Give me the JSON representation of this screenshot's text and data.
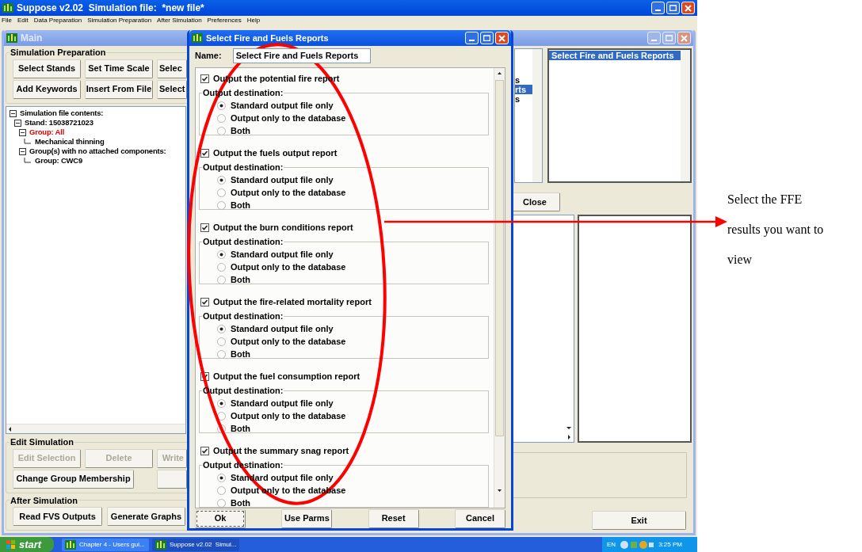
{
  "app_window": {
    "title": "Suppose v2.02  Simulation file:  *new file*"
  },
  "menu_bar": [
    "File",
    "Edit",
    "Data Preparation",
    "Simulation Preparation",
    "After Simulation",
    "Preferences",
    "Help"
  ],
  "main_window": {
    "title": "Main",
    "simulation_preparation": {
      "label": "Simulation Preparation",
      "buttons": [
        {
          "label": "Select Stands"
        },
        {
          "label": "Set Time Scale"
        },
        {
          "label": "Selec"
        },
        {
          "label": "Add Keywords"
        },
        {
          "label": "Insert From File"
        },
        {
          "label": "Select"
        }
      ]
    },
    "tree": [
      {
        "label": "Simulation file contents:",
        "color": "#000000",
        "children": [
          {
            "label": "Stand: 15038721023",
            "color": "#000000",
            "children": [
              {
                "label": "Group: All",
                "color": "#e00000",
                "children": [
                  {
                    "label": "Mechanical thinning",
                    "color": "#000000"
                  }
                ]
              },
              {
                "label": "Group(s) with no attached components:",
                "color": "#000000",
                "children": [
                  {
                    "label": "Group: CWC9",
                    "color": "#000000"
                  }
                ]
              }
            ]
          }
        ]
      }
    ],
    "edit_simulation": {
      "label": "Edit Simulation",
      "buttons": [
        {
          "kind": "text",
          "label": "Edit Selection",
          "disabled": true
        },
        {
          "kind": "text",
          "label": "Delete",
          "disabled": true
        },
        {
          "kind": "text",
          "label": "Write",
          "disabled": true
        },
        {
          "kind": "text",
          "label": "Change Group Membership",
          "disabled": false
        },
        {
          "kind": "blank",
          "disabled": false
        }
      ]
    },
    "after_simulation": {
      "label": "After Simulation",
      "buttons": [
        {
          "label": "Read FVS Outputs"
        },
        {
          "label": "Generate Graphs"
        }
      ]
    },
    "component_list": [
      {
        "label": "s",
        "selected": false
      },
      {
        "label": "rts",
        "selected": true
      },
      {
        "label": "s",
        "selected": false
      }
    ],
    "selected_components": [
      {
        "label": "Select Fire and Fuels Reports",
        "selected": true
      }
    ],
    "close_button": "Close",
    "exit_button": "Exit"
  },
  "dialog": {
    "title": "Select Fire and Fuels Reports",
    "name_label": "Name:",
    "name_value": "Select Fire and Fuels Reports",
    "reports": [
      {
        "label": "Output the potential fire report",
        "checked": true,
        "destination_label": "Output destination:",
        "options": [
          {
            "label": "Standard output file only",
            "selected": true
          },
          {
            "label": "Output only to the database",
            "selected": false
          },
          {
            "label": "Both",
            "selected": false
          }
        ]
      },
      {
        "label": "Output the fuels output report",
        "checked": true,
        "destination_label": "Output destination:",
        "options": [
          {
            "label": "Standard output file only",
            "selected": true
          },
          {
            "label": "Output only to the database",
            "selected": false
          },
          {
            "label": "Both",
            "selected": false
          }
        ]
      },
      {
        "label": "Output the burn conditions report",
        "checked": true,
        "destination_label": "Output destination:",
        "options": [
          {
            "label": "Standard output file only",
            "selected": true
          },
          {
            "label": "Output only to the database",
            "selected": false
          },
          {
            "label": "Both",
            "selected": false
          }
        ]
      },
      {
        "label": "Output the fire-related mortality report",
        "checked": true,
        "destination_label": "Output destination:",
        "options": [
          {
            "label": "Standard output file only",
            "selected": true
          },
          {
            "label": "Output only to the database",
            "selected": false
          },
          {
            "label": "Both",
            "selected": false
          }
        ]
      },
      {
        "label": "Output the fuel consumption report",
        "checked": true,
        "destination_label": "Output destination:",
        "options": [
          {
            "label": "Standard output file only",
            "selected": true
          },
          {
            "label": "Output only to the database",
            "selected": false
          },
          {
            "label": "Both",
            "selected": false
          }
        ]
      },
      {
        "label": "Output the summary snag report",
        "checked": true,
        "destination_label": "Output destination:",
        "options": [
          {
            "label": "Standard output file only",
            "selected": true
          },
          {
            "label": "Output only to the database",
            "selected": false
          },
          {
            "label": "Both",
            "selected": false
          }
        ]
      }
    ],
    "buttons": [
      {
        "label": "Ok",
        "focused": true
      },
      {
        "label": "Use Parms",
        "focused": false
      },
      {
        "label": "Reset",
        "focused": false
      },
      {
        "label": "Cancel",
        "focused": false
      }
    ]
  },
  "taskbar": {
    "start": "start",
    "tasks": [
      {
        "label": "Chapter 4 - Users gui...",
        "selected": false
      },
      {
        "label": "Suppose v2.02  Simul...",
        "selected": true
      }
    ],
    "language": "EN",
    "clock": "3:25 PM"
  },
  "annotation": {
    "text": "Select the FFE results you want to view"
  }
}
